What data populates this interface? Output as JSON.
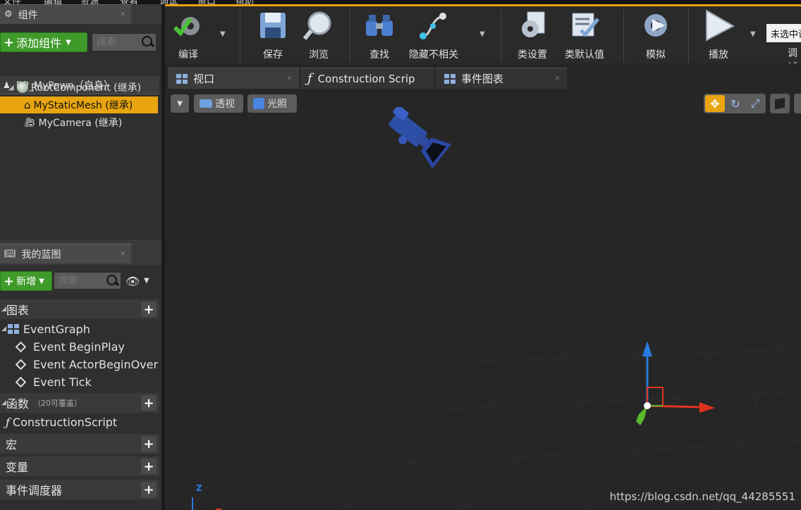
{
  "menu": [
    "文件",
    "编辑",
    "资源",
    "查看",
    "调试",
    "窗口",
    "帮助"
  ],
  "components_panel": {
    "title": "组件",
    "add_button": "添加组件",
    "search_placeholder": "搜索",
    "self_label": "BP_MyPawn（自身）",
    "tree": [
      {
        "label": "RootComponent (继承)",
        "selected": false
      },
      {
        "label": "MyStaticMesh (继承)",
        "selected": true
      },
      {
        "label": "MyCamera (继承)",
        "selected": false
      }
    ]
  },
  "my_blueprint": {
    "title": "我的蓝图",
    "new_button": "新增",
    "search_placeholder": "搜索",
    "sections": {
      "graphs": "图表",
      "functions": "函数",
      "functions_note": "（20可覆盖）",
      "macros": "宏",
      "variables": "变量",
      "dispatchers": "事件调度器"
    },
    "event_graph": "EventGraph",
    "events": [
      "Event BeginPlay",
      "Event ActorBeginOver",
      "Event Tick"
    ],
    "construction_script": "ConstructionScript"
  },
  "toolbar": {
    "compile": "编译",
    "save": "保存",
    "browse": "浏览",
    "find": "查找",
    "hide_unrelated": "隐藏不相关",
    "class_settings": "类设置",
    "class_defaults": "类默认值",
    "simulate": "模拟",
    "play": "播放",
    "debug_filter": "未选中调试对象",
    "debug_label": "调试"
  },
  "tabs": [
    "视口",
    "Construction Scrip",
    "事件图表"
  ],
  "viewport": {
    "perspective": "透视",
    "lit": "光照",
    "axis_z": "Z"
  },
  "watermark": "https://blog.csdn.net/qq_44285551",
  "colors": {
    "accent": "#e8a50f",
    "green_button": "#3f9a2a",
    "axis_x": "#e0341e",
    "axis_y": "#5bb82a",
    "axis_z": "#2a7ae0"
  }
}
